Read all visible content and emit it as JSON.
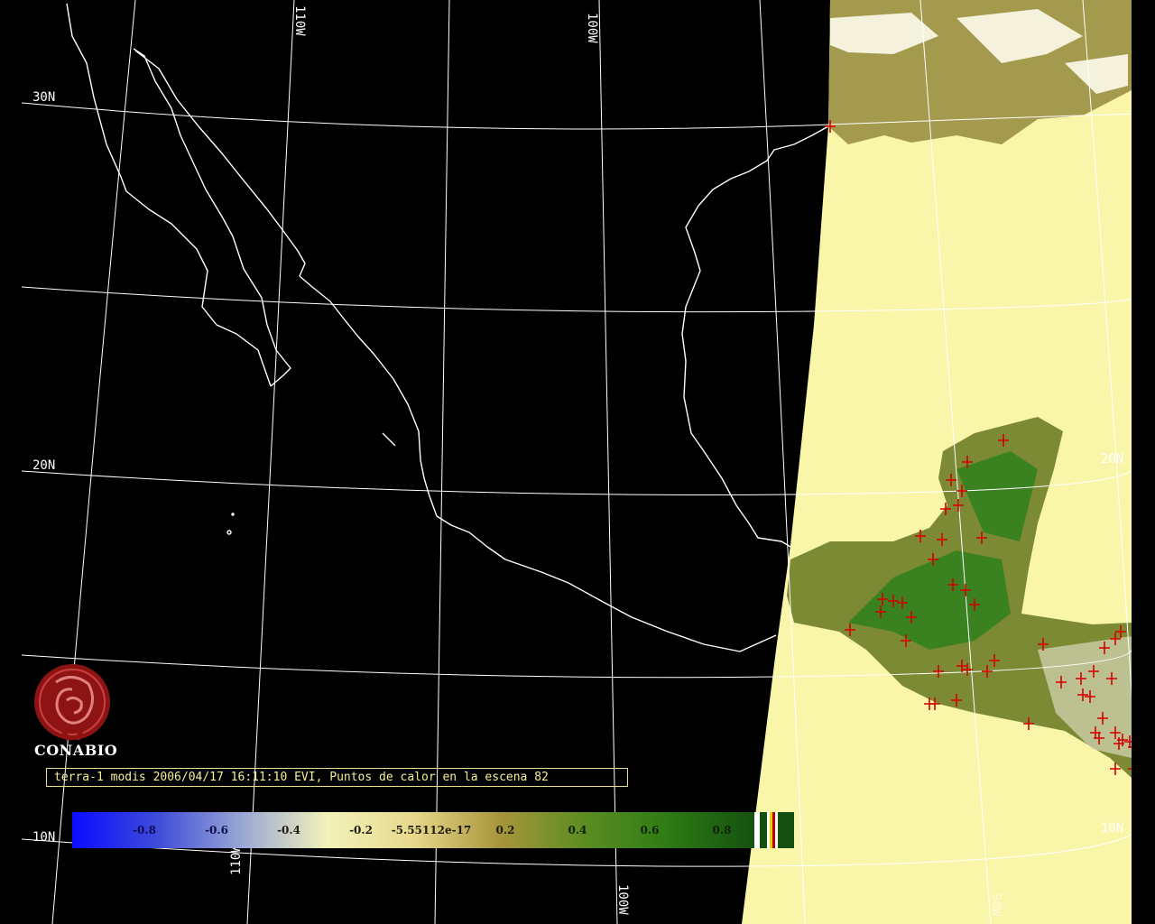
{
  "map": {
    "grid_labels": {
      "lat_30": "30N",
      "lat_20": "20N",
      "lat_20_east": "20N",
      "lat_10": "10N",
      "lat_10_east": "10N",
      "lon_110_top": "110W",
      "lon_100_top": "100W",
      "lon_110_bottom": "110W",
      "lon_100_bottom": "100W",
      "lon_90_bottom": "90W"
    },
    "colors": {
      "background": "#000000",
      "coastline": "#ffffff",
      "graticule": "#ffffff",
      "cloud_sea": "#f9f5a9",
      "vegetation_low": "#a39a4d",
      "vegetation_high": "#2f7f1d",
      "hotspot": "#d40000",
      "caption_border": "#e8e090",
      "caption_text": "#f6ee9a"
    }
  },
  "logo": {
    "icon": "conabio-seal-icon",
    "name": "CONABIO"
  },
  "caption": {
    "text": "terra-1 modis 2006/04/17 16:11:10 EVI, Puntos de calor en la escena 82"
  },
  "colorbar": {
    "ticks": [
      "-0.8",
      "-0.6",
      "-0.4",
      "-0.2",
      "-5.55112e-17",
      "0.2",
      "0.4",
      "0.6",
      "0.8"
    ],
    "gradient_stops": [
      "#0b0bff",
      "#3e4cd9",
      "#9aa8d4",
      "#f3f2b9",
      "#e7d98c",
      "#a9953b",
      "#5c8d22",
      "#2d7b14",
      "#155010"
    ],
    "end_swatches": [
      "#ffffff",
      "#144e10",
      "#ffffff",
      "#e8d000",
      "#c00000",
      "#ffffff",
      "#144e10"
    ]
  }
}
